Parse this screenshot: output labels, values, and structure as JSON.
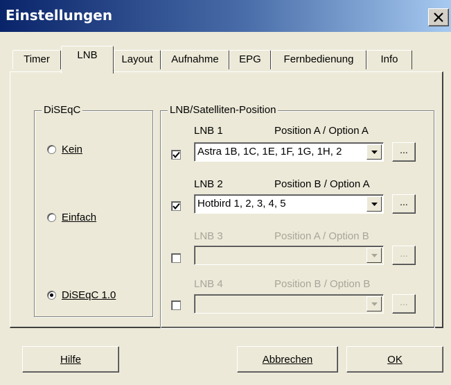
{
  "window": {
    "title": "Einstellungen"
  },
  "tabs": [
    {
      "label": "Timer"
    },
    {
      "label": "LNB"
    },
    {
      "label": "Layout"
    },
    {
      "label": "Aufnahme"
    },
    {
      "label": "EPG"
    },
    {
      "label": "Fernbedienung"
    },
    {
      "label": "Info"
    }
  ],
  "active_tab": "LNB",
  "diseqc": {
    "title": "DiSEqC",
    "options": [
      {
        "label": "Kein",
        "selected": false
      },
      {
        "label": "Einfach",
        "selected": false
      },
      {
        "label": "DiSEqC 1.0",
        "selected": true
      }
    ]
  },
  "lnb_group": {
    "title": "LNB/Satelliten-Position",
    "rows": [
      {
        "name": "LNB 1",
        "position": "Position A / Option A",
        "checked": true,
        "enabled": true,
        "value": "Astra 1B, 1C, 1E, 1F, 1G, 1H, 2"
      },
      {
        "name": "LNB 2",
        "position": "Position B / Option A",
        "checked": true,
        "enabled": true,
        "value": "Hotbird 1, 2, 3, 4, 5"
      },
      {
        "name": "LNB 3",
        "position": "Position A / Option B",
        "checked": false,
        "enabled": false,
        "value": ""
      },
      {
        "name": "LNB 4",
        "position": "Position B / Option B",
        "checked": false,
        "enabled": false,
        "value": ""
      }
    ],
    "browse_label": "..."
  },
  "buttons": {
    "help": "Hilfe",
    "cancel": "Abbrechen",
    "ok": "OK"
  },
  "colors": {
    "titlebar_start": "#0a246a",
    "titlebar_end": "#a6caf0",
    "face": "#ece9d8",
    "disabled_text": "#a8a59a"
  }
}
